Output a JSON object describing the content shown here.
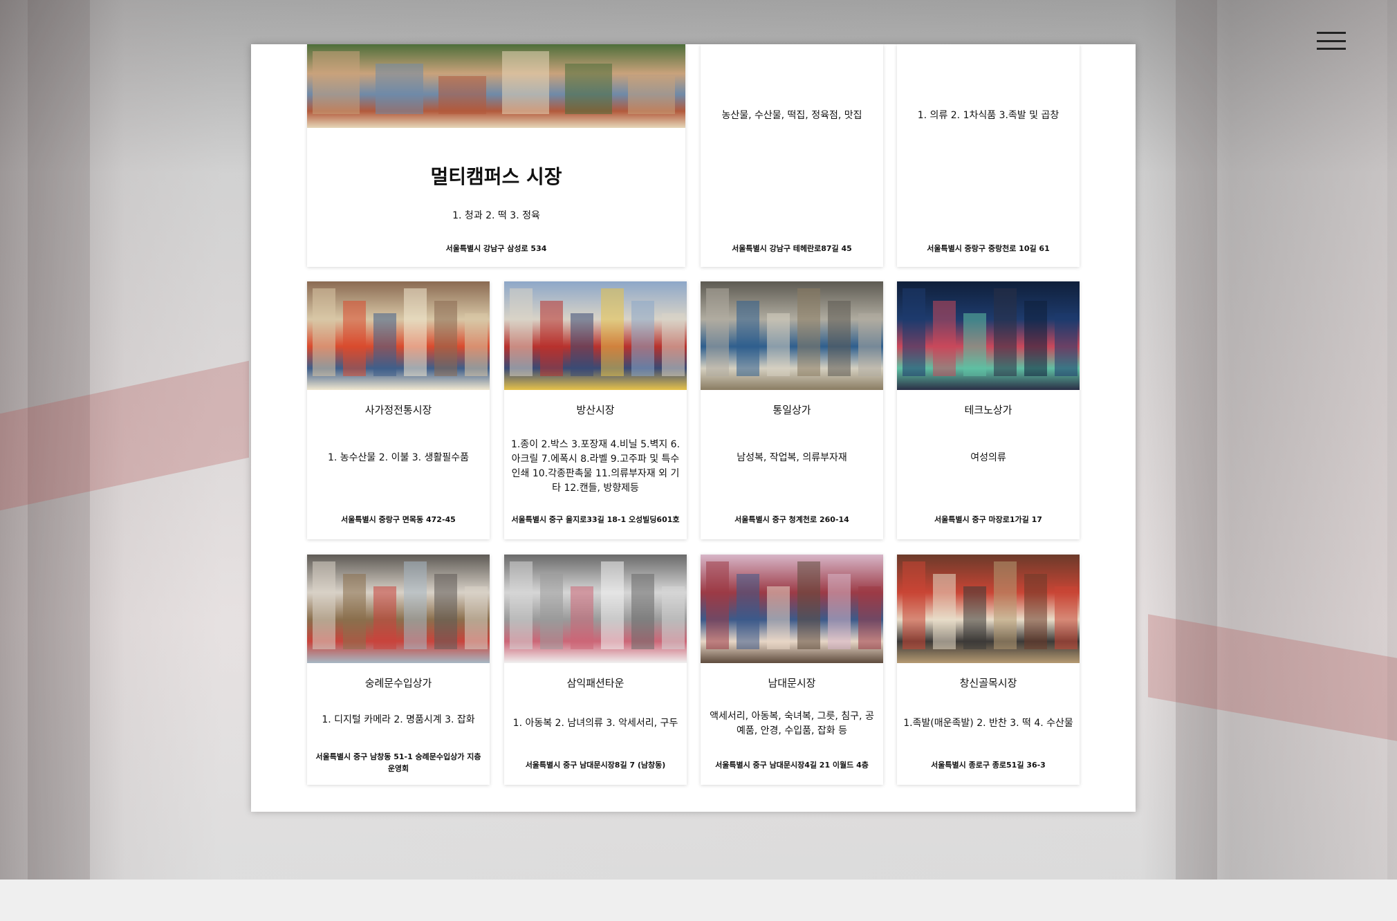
{
  "menu": {
    "icon": "hamburger-menu-icon"
  },
  "markets": [
    {
      "name": "멀티캠퍼스 시장",
      "items": "1. 청과 2. 떡 3. 정육",
      "address": "서울특별시 강남구 삼성로 534",
      "photo": "scene-market-street-illustration"
    },
    {
      "name": "",
      "items": "농산물, 수산물, 떡집, 정육점, 맛집",
      "address": "서울특별시 강남구 테헤란로87길 45",
      "photo": ""
    },
    {
      "name": "",
      "items": "1. 의류 2. 1차식품 3.족발 및 곱창",
      "address": "서울특별시 중랑구 중랑천로 10길 61",
      "photo": ""
    },
    {
      "name": "사가정전통시장",
      "items": "1. 농수산물 2. 이불 3. 생활필수품",
      "address": "서울특별시 중랑구 면목동 472-45",
      "photo": "market-street-photo"
    },
    {
      "name": "방산시장",
      "items": "1.종이 2.박스 3.포장재 4.비닐 5.벽지 6.아크릴 7.에폭시 8.라벨 9.고주파 및 특수인쇄 10.각종판촉물 11.의류부자재 외 기타 12.캔들, 방향제등",
      "address": "서울특별시 중구 을지로33길 18-1 오성빌딩601호",
      "photo": "market-street-photo"
    },
    {
      "name": "통일상가",
      "items": "남성복, 작업복, 의류부자재",
      "address": "서울특별시 중구 청계천로 260-14",
      "photo": "market-entrance-photo"
    },
    {
      "name": "테크노상가",
      "items": "여성의류",
      "address": "서울특별시 중구 마장로1가길 17",
      "photo": "building-night-photo"
    },
    {
      "name": "숭례문수입상가",
      "items": "1. 디지털 카메라 2. 명품시계 3. 잡화",
      "address": "서울특별시 중구 남창동 51-1 숭례문수입상가 지층 운영회",
      "photo": "shop-goods-collage-photo"
    },
    {
      "name": "삼익패션타운",
      "items": "1. 아동복 2. 남녀의류 3. 악세서리, 구두",
      "address": "서울특별시 중구 남대문시장8길 7 (남창동)",
      "photo": "building-facade-photo"
    },
    {
      "name": "남대문시장",
      "items": "액세서리, 아동복, 숙녀복, 그릇, 침구, 공예품, 안경, 수입품, 잡화 등",
      "address": "서울특별시 중구 남대문시장4길 21 이월드 4층",
      "photo": "crowded-market-photo"
    },
    {
      "name": "창신골목시장",
      "items": "1.족발(매운족발) 2. 반찬 3. 떡 4. 수산물",
      "address": "서울특별시 종로구 종로51길 36-3",
      "photo": "food-market-photo"
    }
  ]
}
